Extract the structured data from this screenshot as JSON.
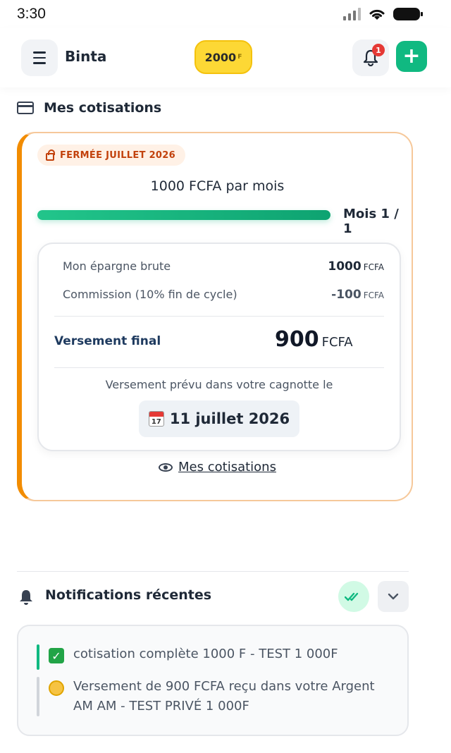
{
  "status_bar": {
    "time": "3:30"
  },
  "header": {
    "user_name": "Binta",
    "balance": "2000",
    "balance_unit": "F",
    "notification_count": "1"
  },
  "section": {
    "title": "Mes cotisations"
  },
  "cotisation": {
    "status_badge": "FERMÉE JUILLET 2026",
    "amount_per_month": "1000 FCFA par mois",
    "progress": 1.0,
    "month_label": "Mois 1 / 1",
    "gross_savings_label": "Mon épargne brute",
    "gross_savings_value": "1000",
    "gross_savings_unit": "FCFA",
    "commission_label": "Commission (10% fin de cycle)",
    "commission_value": "-100",
    "commission_unit": "FCFA",
    "final_label": "Versement final",
    "final_value": "900",
    "final_unit": "FCFA",
    "planned_text": "Versement prévu dans votre cagnotte le",
    "planned_date": "11 juillet 2026",
    "calendar_month": "July",
    "calendar_day": "17",
    "view_link": "Mes cotisations"
  },
  "notifications": {
    "title": "Notifications récentes",
    "items": [
      {
        "icon": "check-mark-icon",
        "text": "cotisation complète 1000 F - TEST 1 000F",
        "accent": "#10b981"
      },
      {
        "icon": "coin-icon",
        "text": "Versement de 900 FCFA reçu dans votre Argent AM AM - TEST PRIVÉ 1 000F",
        "accent": "#d1d5db"
      }
    ]
  },
  "colors": {
    "accent_green": "#10b981",
    "accent_orange": "#f28c00",
    "balance_yellow": "#fdd835"
  }
}
